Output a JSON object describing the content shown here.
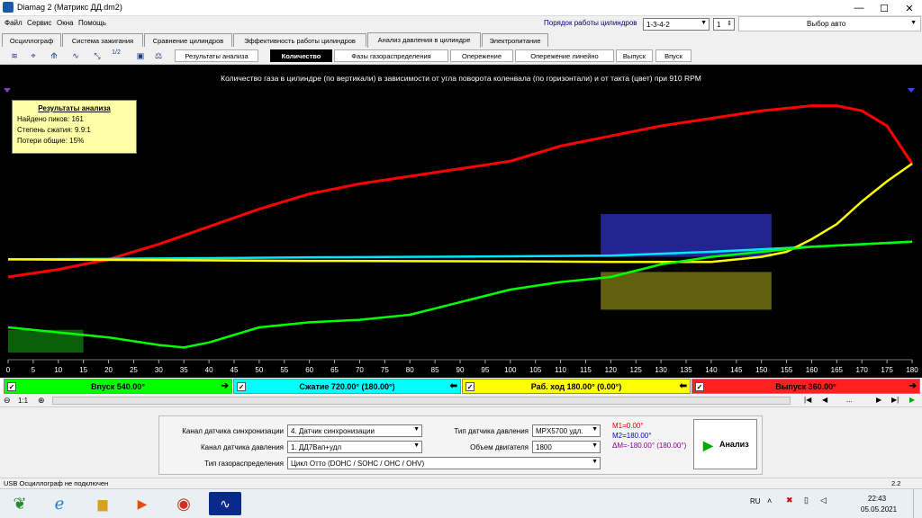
{
  "window": {
    "title": "Diamag 2 (Матрикс ДД.dm2)",
    "min": "—",
    "max": "☐",
    "close": "✕"
  },
  "menu": [
    "Файл",
    "Сервис",
    "Окна",
    "Помощь"
  ],
  "cyl_order": {
    "label": "Порядок работы цилиндров",
    "value": "1-3-4-2",
    "cylinder": "1",
    "auto": "Выбор авто"
  },
  "tabs": [
    {
      "label": "Осциллограф",
      "color": "#d8eef0"
    },
    {
      "label": "Система зажигания",
      "color": "#e8c8e8"
    },
    {
      "label": "Сравнение цилиндров",
      "color": "#e8f0b0"
    },
    {
      "label": "Эффективность работы цилиндров",
      "color": "#c8c8f0"
    },
    {
      "label": "Анализ давления в цилиндре",
      "color": "#ffffff"
    },
    {
      "label": "Электропитание",
      "color": "#f0c8c8"
    }
  ],
  "toolbar_icons": [
    "wave-icon",
    "cursor-icon",
    "auto-icon",
    "graph-icon",
    "zoom-icon",
    "half-icon",
    "save-icon",
    "scale-icon"
  ],
  "toolbar_text": [
    "",
    "",
    "",
    "",
    "",
    "1/2",
    "",
    ""
  ],
  "subtabs": [
    "Результаты анализа",
    "Количество",
    "Фазы газораспределения",
    "Опережение",
    "Опережение линейно",
    "Выпуск",
    "Впуск"
  ],
  "chart_data": {
    "type": "line",
    "title": "Количество газа в цилиндре (по вертикали) в зависимости от угла поворота коленвала (по горизонтали) и от такта (цвет) при 910 RPM",
    "x_ticks": [
      "0",
      "5",
      "10",
      "15",
      "20",
      "25",
      "30",
      "35",
      "40",
      "45",
      "50",
      "55",
      "60",
      "65",
      "70",
      "75",
      "80",
      "85",
      "90",
      "95",
      "100",
      "105",
      "110",
      "115",
      "120",
      "125",
      "130",
      "135",
      "140",
      "145",
      "150",
      "155",
      "160",
      "165",
      "170",
      "175",
      "180"
    ],
    "xlim": [
      0,
      180
    ],
    "series": [
      {
        "color": "#ff0000",
        "x": [
          0,
          10,
          20,
          30,
          40,
          50,
          60,
          70,
          80,
          90,
          100,
          110,
          120,
          130,
          140,
          150,
          160,
          165,
          170,
          175,
          180
        ],
        "y": [
          0.3,
          0.33,
          0.37,
          0.43,
          0.5,
          0.57,
          0.63,
          0.67,
          0.7,
          0.73,
          0.76,
          0.82,
          0.86,
          0.9,
          0.93,
          0.96,
          0.98,
          0.98,
          0.96,
          0.9,
          0.75
        ]
      },
      {
        "color": "#00e8ff",
        "x": [
          0,
          20,
          40,
          60,
          80,
          100,
          120,
          140,
          160,
          180
        ],
        "y": [
          0.37,
          0.372,
          0.375,
          0.378,
          0.38,
          0.382,
          0.385,
          0.4,
          0.42,
          0.44
        ]
      },
      {
        "color": "#ffff00",
        "x": [
          0,
          20,
          40,
          60,
          80,
          100,
          120,
          140,
          150,
          155,
          160,
          165,
          170,
          175,
          180
        ],
        "y": [
          0.37,
          0.368,
          0.366,
          0.364,
          0.363,
          0.362,
          0.36,
          0.36,
          0.38,
          0.4,
          0.45,
          0.51,
          0.6,
          0.68,
          0.75
        ]
      },
      {
        "color": "#00ff00",
        "x": [
          0,
          10,
          15,
          20,
          30,
          35,
          40,
          50,
          60,
          70,
          80,
          90,
          100,
          110,
          120,
          130,
          140,
          150,
          160,
          170,
          180
        ],
        "y": [
          0.1,
          0.08,
          0.07,
          0.06,
          0.03,
          0.02,
          0.04,
          0.1,
          0.12,
          0.13,
          0.15,
          0.2,
          0.25,
          0.28,
          0.3,
          0.35,
          0.38,
          0.4,
          0.42,
          0.43,
          0.44
        ]
      }
    ],
    "ylim": [
      0,
      1
    ],
    "overlays": [
      {
        "color": "#0a6a0a",
        "x": [
          0,
          15
        ],
        "y": [
          0.0,
          0.09
        ]
      },
      {
        "color": "#2828a0",
        "x": [
          118,
          152
        ],
        "y": [
          0.38,
          0.55
        ]
      },
      {
        "color": "#6a6a10",
        "x": [
          118,
          152
        ],
        "y": [
          0.17,
          0.32
        ]
      }
    ]
  },
  "results": {
    "title": "Результаты анализа",
    "peaks": "Найдено пиков: 161",
    "compression": "Степень сжатия: 9.9:1",
    "losses": "Потери общие: 15%"
  },
  "phases": [
    {
      "label": "Впуск 540.00°",
      "color": "#00ff00"
    },
    {
      "label": "Сжатие 720.00° (180.00°)",
      "color": "#00ffff"
    },
    {
      "label": "Раб. ход 180.00° (0.00°)",
      "color": "#ffff00"
    },
    {
      "label": "Выпуск 360.00°",
      "color": "#ff2020"
    }
  ],
  "scroll": {
    "zoom": "1:1",
    "dots": "..."
  },
  "panel": {
    "sync_label": "Канал датчика синхронизации",
    "sync_value": "4. Датчик синхронизации",
    "press_label": "Канал датчика давления",
    "press_value": "1. ДД7Вап+удл",
    "gas_label": "Тип газораспределения",
    "gas_value": "Цикл Отто (DOHC / SOHC / OHC / OHV)",
    "sensor_label": "Тип датчика давления",
    "sensor_value": "MPX5700 удл.",
    "volume_label": "Объем двигателя",
    "volume_value": "1800",
    "m1": "M1=0.00°",
    "m2": "M2=180.00°",
    "dm": "ΔM=-180.00° (180.00°)",
    "analyze": "Анализ"
  },
  "status": {
    "left": "USB Осциллограф не подключен",
    "right": "2.2"
  },
  "tray": {
    "lang": "RU",
    "time": "22:43",
    "date": "05.05.2021"
  }
}
